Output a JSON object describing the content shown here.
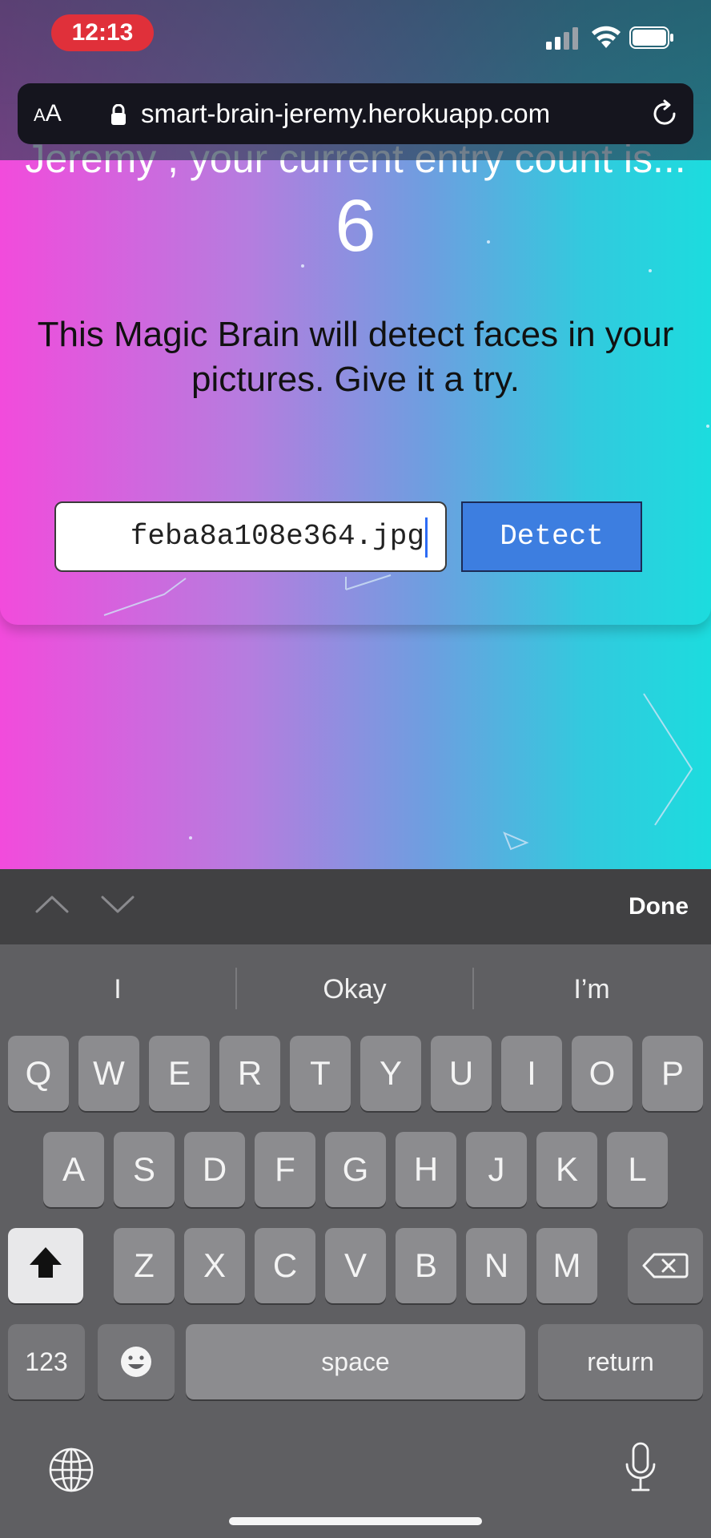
{
  "status_bar": {
    "time": "12:13"
  },
  "browser": {
    "aa_small": "A",
    "aa_large": "A",
    "url": "smart-brain-jeremy.herokuapp.com"
  },
  "app": {
    "entry_count_text": "Jeremy , your current entry count is...",
    "entry_count": "6",
    "description": "This Magic Brain will detect faces in your pictures. Give it a try.",
    "image_url_value": "feba8a108e364.jpg",
    "detect_label": "Detect"
  },
  "keyboard_toolbar": {
    "done_label": "Done"
  },
  "suggestions": [
    "I",
    "Okay",
    "I’m"
  ],
  "keyboard": {
    "row1": [
      "Q",
      "W",
      "E",
      "R",
      "T",
      "Y",
      "U",
      "I",
      "O",
      "P"
    ],
    "row2": [
      "A",
      "S",
      "D",
      "F",
      "G",
      "H",
      "J",
      "K",
      "L"
    ],
    "row3": [
      "Z",
      "X",
      "C",
      "V",
      "B",
      "N",
      "M"
    ],
    "numbers_label": "123",
    "space_label": "space",
    "return_label": "return"
  }
}
